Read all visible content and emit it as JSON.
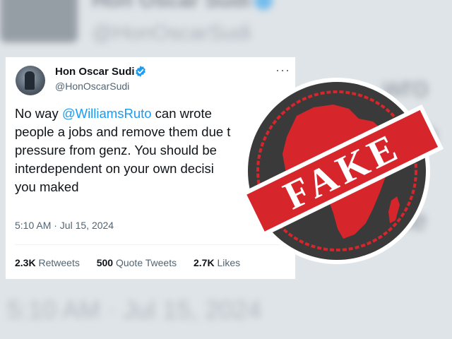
{
  "background": {
    "name": "Hon Oscar Sudi",
    "handle": "@HonOscarSudi",
    "right_lines": [
      "wro",
      "ob",
      "c",
      "de"
    ],
    "date": "5:10 AM · Jul 15, 2024"
  },
  "tweet": {
    "name": "Hon Oscar Sudi",
    "handle": "@HonOscarSudi",
    "more_icon": "···",
    "lines": [
      {
        "pre": "No way ",
        "mention": "@WilliamsRuto",
        "post": " can wrote"
      },
      {
        "text": "people a jobs and remove them due t"
      },
      {
        "text": "pressure from genz. You should be"
      },
      {
        "text": "interdependent on your own decisi"
      },
      {
        "text": "you maked"
      }
    ],
    "time": "5:10 AM · Jul 15, 2024",
    "stats": {
      "retweets_count": "2.3K",
      "retweets_label": "Retweets",
      "quotes_count": "500",
      "quotes_label": "Quote Tweets",
      "likes_count": "2.7K",
      "likes_label": "Likes"
    }
  },
  "stamp": {
    "label": "FAKE",
    "colors": {
      "red": "#d7262b",
      "dark": "#3a3a3a",
      "white": "#ffffff"
    }
  },
  "colors": {
    "mention": "#1d9bf0",
    "verified": "#1d9bf0",
    "text": "#0f1419",
    "secondary": "#536471"
  }
}
